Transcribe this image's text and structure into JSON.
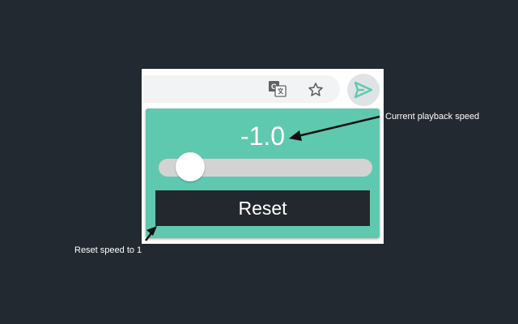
{
  "toolbar": {
    "icons": {
      "translate": "translate-icon",
      "bookmark": "star-icon",
      "extension": "send-arrow-icon"
    },
    "extension_color": "#5ec9ae"
  },
  "popup": {
    "speed_value": "-1.0",
    "slider_level": 0.09,
    "reset_label": "Reset",
    "colors": {
      "background": "#5ec9ae",
      "button": "#22282e",
      "track": "#d3d3d3"
    }
  },
  "annotations": {
    "speed_callout": "Current playback speed",
    "reset_callout": "Reset speed to 1"
  },
  "page_background": "#232930"
}
